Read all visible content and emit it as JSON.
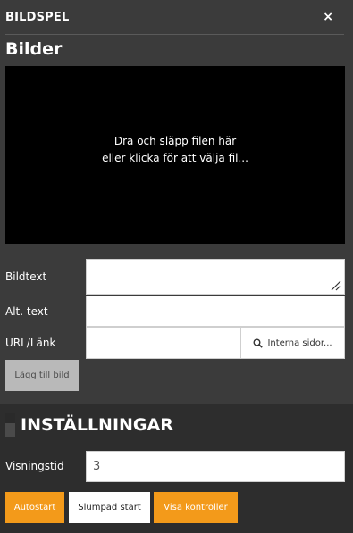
{
  "panel": {
    "title": "BILDSPEL",
    "close_label": "×"
  },
  "images": {
    "title": "Bilder",
    "dropzone_line1": "Dra och släpp filen här",
    "dropzone_line2": "eller klicka för att välja fil..."
  },
  "fields": {
    "caption_label": "Bildtext",
    "caption_value": "",
    "alt_label": "Alt. text",
    "alt_value": "",
    "url_label": "URL/Länk",
    "url_value": "",
    "internal_pages_label": "Interna sidor...",
    "add_image_label": "Lägg till bild"
  },
  "settings": {
    "title": "INSTÄLLNINGAR",
    "display_time_label": "Visningstid",
    "display_time_value": "3",
    "autostart_label": "Autostart",
    "random_start_label": "Slumpad start",
    "show_controls_label": "Visa kontroller"
  },
  "colors": {
    "background": "#3b3b3b",
    "settings_background": "#2d2d2d",
    "accent": "#f39a1a",
    "disabled_button": "#b9b9b9"
  },
  "icons": {
    "close": "close-icon",
    "search": "search-icon",
    "resize": "resize-handle-icon"
  }
}
